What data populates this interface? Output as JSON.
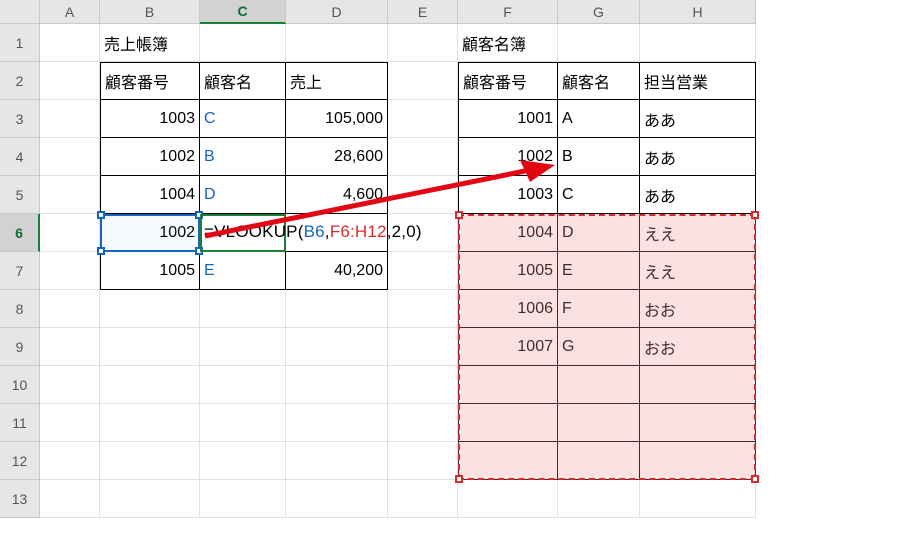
{
  "columns": [
    "A",
    "B",
    "C",
    "D",
    "E",
    "F",
    "G",
    "H"
  ],
  "rowNumbers": [
    "1",
    "2",
    "3",
    "4",
    "5",
    "6",
    "7",
    "8",
    "9",
    "10",
    "11",
    "12",
    "13"
  ],
  "selectedColumn": "C",
  "selectedRow": "6",
  "leftTable": {
    "title": "売上帳簿",
    "headers": {
      "id": "顧客番号",
      "name": "顧客名",
      "sales": "売上"
    },
    "rows": [
      {
        "id": "1003",
        "name": "C",
        "sales": "105,000"
      },
      {
        "id": "1002",
        "name": "B",
        "sales": "28,600"
      },
      {
        "id": "1004",
        "name": "D",
        "sales": "4,600"
      },
      {
        "id": "1002",
        "name": "",
        "sales": ""
      },
      {
        "id": "1005",
        "name": "E",
        "sales": "40,200"
      }
    ]
  },
  "rightTable": {
    "title": "顧客名簿",
    "headers": {
      "id": "顧客番号",
      "name": "顧客名",
      "rep": "担当営業"
    },
    "rows": [
      {
        "id": "1001",
        "name": "A",
        "rep": "ああ"
      },
      {
        "id": "1002",
        "name": "B",
        "rep": "ああ"
      },
      {
        "id": "1003",
        "name": "C",
        "rep": "ああ"
      },
      {
        "id": "1004",
        "name": "D",
        "rep": "ええ"
      },
      {
        "id": "1005",
        "name": "E",
        "rep": "ええ"
      },
      {
        "id": "1006",
        "name": "F",
        "rep": "おお"
      },
      {
        "id": "1007",
        "name": "G",
        "rep": "おお"
      }
    ]
  },
  "formula": {
    "prefix": "=VLOOKUP(",
    "arg1": "B6",
    "argSep1": ",",
    "arg2": "F6:H12",
    "suffix": ",2,0)"
  }
}
